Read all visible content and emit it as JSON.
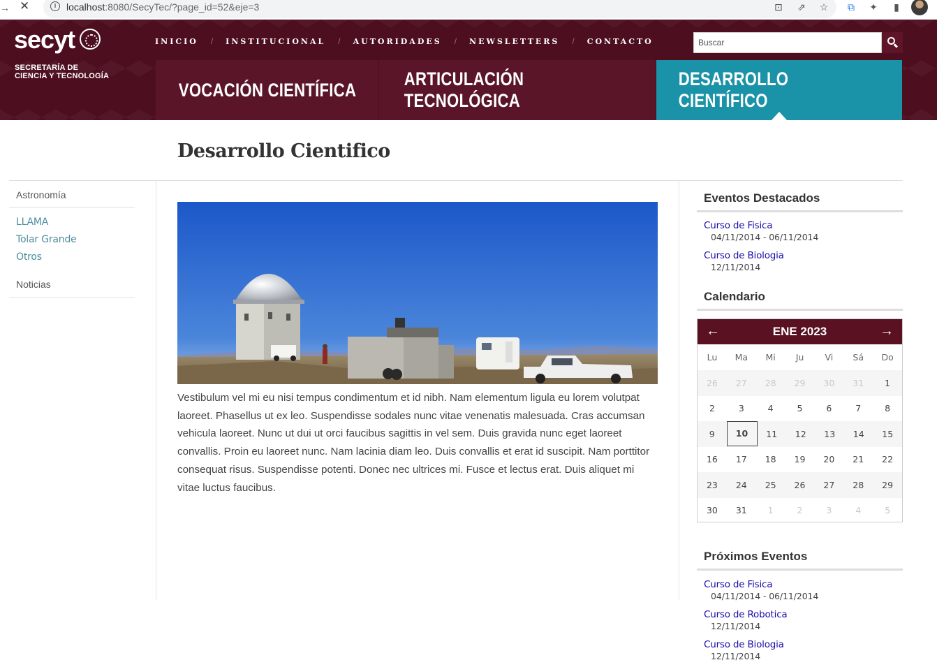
{
  "browser": {
    "url_host": "localhost",
    "url_path": ":8080/SecyTec/?page_id=52&eje=3"
  },
  "brand": {
    "logo": "secyt",
    "subtitle_line1": "SECRETARÍA DE",
    "subtitle_line2": "CIENCIA Y TECNOLOGÍA"
  },
  "topnav": [
    "INICIO",
    "INSTITUCIONAL",
    "AUTORIDADES",
    "NEWSLETTERS",
    "CONTACTO"
  ],
  "search": {
    "placeholder": "Buscar"
  },
  "axes": [
    {
      "label": "VOCACIÓN CIENTÍFICA",
      "active": false
    },
    {
      "label": "ARTICULACIÓN TECNOLÓGICA",
      "active": false
    },
    {
      "label": "DESARROLLO CIENTÍFICO",
      "active": true
    }
  ],
  "page": {
    "title": "Desarrollo Cientifico",
    "body": "Vestibulum vel mi eu nisi tempus condimentum et id nibh. Nam elementum ligula eu lorem volutpat laoreet. Phasellus ut ex leo. Suspendisse sodales nunc vitae venenatis malesuada. Cras accumsan vehicula laoreet. Nunc ut dui ut orci faucibus sagittis in vel sem. Duis gravida nunc eget laoreet convallis. Proin eu laoreet nunc. Nam lacinia diam leo. Duis convallis et erat id suscipit. Nam porttitor consequat risus. Suspendisse potenti. Donec nec ultrices mi. Fusce et lectus erat. Duis aliquet mi vitae luctus faucibus."
  },
  "sidebar": {
    "section1": "Astronomía",
    "links": [
      "LLAMA",
      "Tolar Grande",
      "Otros"
    ],
    "section2": "Noticias"
  },
  "featured": {
    "title": "Eventos Destacados",
    "events": [
      {
        "name": "Curso de Fisica",
        "date": "04/11/2014 - 06/11/2014"
      },
      {
        "name": "Curso de Biologia",
        "date": "12/11/2014"
      }
    ]
  },
  "calendar": {
    "title": "Calendario",
    "month": "ENE 2023",
    "dow": [
      "Lu",
      "Ma",
      "Mi",
      "Ju",
      "Vi",
      "Sá",
      "Do"
    ],
    "weeks": [
      [
        "26",
        "27",
        "28",
        "29",
        "30",
        "31",
        "1"
      ],
      [
        "2",
        "3",
        "4",
        "5",
        "6",
        "7",
        "8"
      ],
      [
        "9",
        "10",
        "11",
        "12",
        "13",
        "14",
        "15"
      ],
      [
        "16",
        "17",
        "18",
        "19",
        "20",
        "21",
        "22"
      ],
      [
        "23",
        "24",
        "25",
        "26",
        "27",
        "28",
        "29"
      ],
      [
        "30",
        "31",
        "1",
        "2",
        "3",
        "4",
        "5"
      ]
    ],
    "today": "10"
  },
  "upcoming": {
    "title": "Próximos Eventos",
    "events": [
      {
        "name": "Curso de Fisica",
        "date": "04/11/2014 - 06/11/2014"
      },
      {
        "name": "Curso de Robotica",
        "date": "12/11/2014"
      },
      {
        "name": "Curso de Biologia",
        "date": "12/11/2014"
      }
    ]
  },
  "colors": {
    "header": "#4d0f1f",
    "active_axis": "#1a93a8",
    "calendar_head": "#5a1122",
    "sidebar_link": "#4c8e9e",
    "event_link": "#1a0dab"
  }
}
